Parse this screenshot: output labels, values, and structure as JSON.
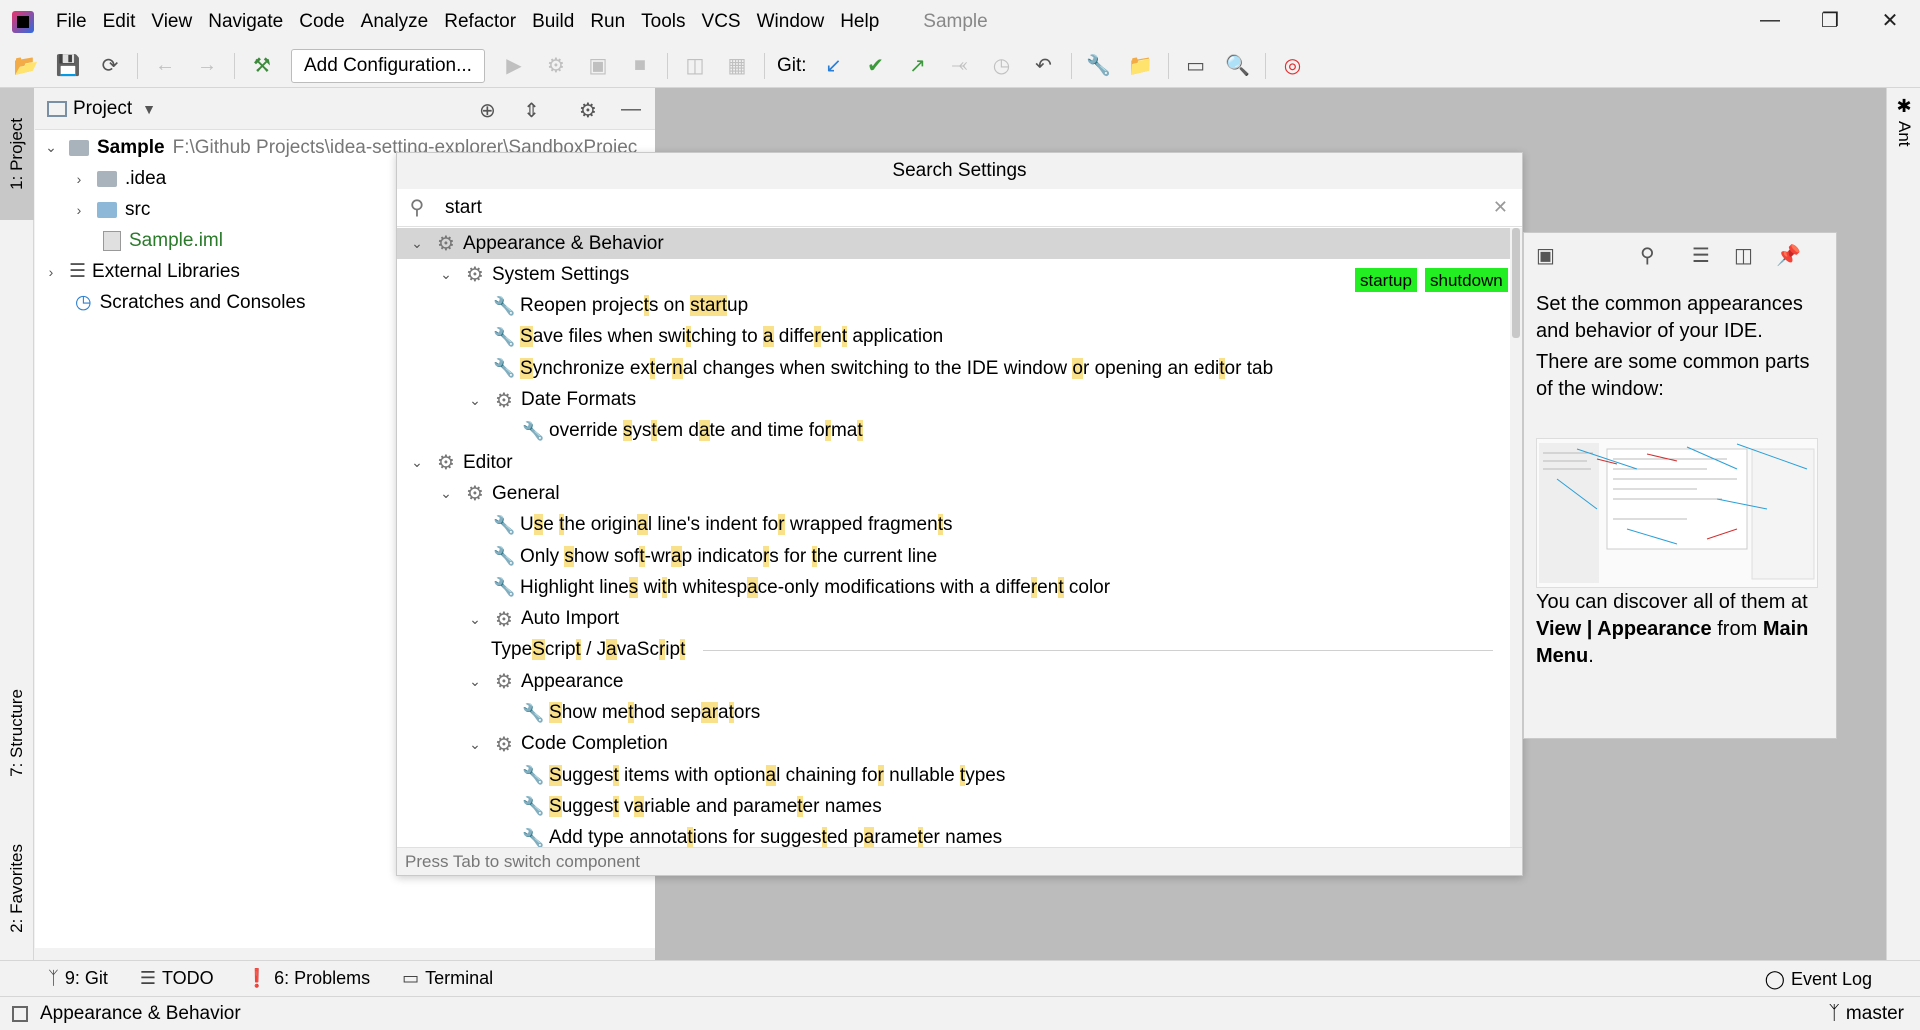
{
  "window": {
    "title": "Sample"
  },
  "menu": [
    "File",
    "Edit",
    "View",
    "Navigate",
    "Code",
    "Analyze",
    "Refactor",
    "Build",
    "Run",
    "Tools",
    "VCS",
    "Window",
    "Help"
  ],
  "toolbar": {
    "add_config_label": "Add Configuration...",
    "git_label": "Git:"
  },
  "left_strip": {
    "project": "1: Project",
    "structure": "7: Structure",
    "favorites": "2: Favorites"
  },
  "right_strip": {
    "ant": "Ant"
  },
  "project": {
    "title": "Project",
    "tree": [
      {
        "label": "Sample",
        "detail": "F:\\Github Projects\\idea-setting-explorer\\SandboxProjec"
      },
      {
        "label": ".idea"
      },
      {
        "label": "src"
      },
      {
        "label": "Sample.iml"
      },
      {
        "label": "External Libraries"
      },
      {
        "label": "Scratches and Consoles"
      }
    ]
  },
  "search": {
    "title": "Search Settings",
    "query": "start",
    "hint": "Press Tab to switch component",
    "tags": [
      "startup",
      "shutdown"
    ],
    "results": [
      {
        "level": 0,
        "type": "group",
        "expanded": true,
        "selected": true,
        "text": "Appearance & Behavior"
      },
      {
        "level": 1,
        "type": "group",
        "expanded": true,
        "text": "System Settings"
      },
      {
        "level": 2,
        "type": "option",
        "html": "Reopen projec<span class=\"hl\">t</span>s on <span class=\"hl\">start</span>up"
      },
      {
        "level": 2,
        "type": "option",
        "html": "<span class=\"hl\">S</span>ave files when swi<span class=\"hl\">t</span>ching to <span class=\"hl\">a</span> diffe<span class=\"hl\">r</span>en<span class=\"hl\">t</span> application"
      },
      {
        "level": 2,
        "type": "option",
        "html": "<span class=\"hl\">S</span>ynchronize ex<span class=\"hl\">t</span>er<span class=\"hl\">n</span>al changes when switching to the IDE window <span class=\"hl\">o</span>r opening an edi<span class=\"hl\">t</span>or tab"
      },
      {
        "level": 2,
        "type": "group",
        "expanded": true,
        "text": "Date Formats"
      },
      {
        "level": 3,
        "type": "option",
        "html": "override <span class=\"hl\">s</span>ys<span class=\"hl\">t</span>em d<span class=\"hl\">a</span>te and time fo<span class=\"hl\">r</span>ma<span class=\"hl\">t</span>"
      },
      {
        "level": 0,
        "type": "group",
        "expanded": true,
        "text": "Editor"
      },
      {
        "level": 1,
        "type": "group",
        "expanded": true,
        "text": "General"
      },
      {
        "level": 2,
        "type": "option",
        "html": "U<span class=\"hl\">s</span>e <span class=\"hl\">t</span>he origin<span class=\"hl\">a</span>l line's indent fo<span class=\"hl\">r</span> wrapped fragmen<span class=\"hl\">t</span>s"
      },
      {
        "level": 2,
        "type": "option",
        "html": "Only <span class=\"hl\">s</span>how sof<span class=\"hl\">t</span>-wr<span class=\"hl\">a</span>p indicato<span class=\"hl\">r</span>s for <span class=\"hl\">t</span>he current line"
      },
      {
        "level": 2,
        "type": "option",
        "html": "Highlight line<span class=\"hl\">s</span> wi<span class=\"hl\">t</span>h whitesp<span class=\"hl\">a</span>ce-only modifications with a diffe<span class=\"hl\">r</span>en<span class=\"hl\">t</span> color"
      },
      {
        "level": 2,
        "type": "group",
        "expanded": true,
        "text": "Auto Import"
      },
      {
        "level": 2,
        "type": "separator",
        "html": "Type<span class=\"hl\">S</span>crip<span class=\"hl\">t</span> / J<span class=\"hl\">a</span>vaSc<span class=\"hl\">r</span>ip<span class=\"hl\">t</span>"
      },
      {
        "level": 2,
        "type": "group",
        "expanded": true,
        "text": "Appearance"
      },
      {
        "level": 3,
        "type": "option",
        "html": "<span class=\"hl\">S</span>how me<span class=\"hl\">t</span>hod sep<span class=\"hl\">ar</span>a<span class=\"hl\">t</span>ors"
      },
      {
        "level": 2,
        "type": "group",
        "expanded": true,
        "text": "Code Completion"
      },
      {
        "level": 3,
        "type": "option",
        "html": "<span class=\"hl\">S</span>ugges<span class=\"hl\">t</span> items with option<span class=\"hl\">a</span>l chaining fo<span class=\"hl\">r</span> nullable <span class=\"hl\">t</span>ypes"
      },
      {
        "level": 3,
        "type": "option",
        "html": "<span class=\"hl\">S</span>ugges<span class=\"hl\">t</span> v<span class=\"hl\">a</span>riable and parame<span class=\"hl\">t</span>er names"
      },
      {
        "level": 3,
        "type": "option",
        "html": "Add type annota<span class=\"hl\">t</span>ions for sugges<span class=\"hl\">t</span>ed p<span class=\"hl\">a</span>rame<span class=\"hl\">t</span>er names"
      }
    ]
  },
  "help": {
    "p1": "Set the common appearances and behavior of your IDE.",
    "p2": "There are some common parts of the window:",
    "p3_pre": "You can discover all of them at ",
    "p3_bold1": "View | Appearance",
    "p3_mid": " from ",
    "p3_bold2": "Main Menu",
    "p3_post": "."
  },
  "bottom_tools": {
    "git": "9: Git",
    "todo": "TODO",
    "problems": "6: Problems",
    "terminal": "Terminal",
    "event_log": "Event Log"
  },
  "status": {
    "text": "Appearance & Behavior",
    "branch": "master"
  }
}
